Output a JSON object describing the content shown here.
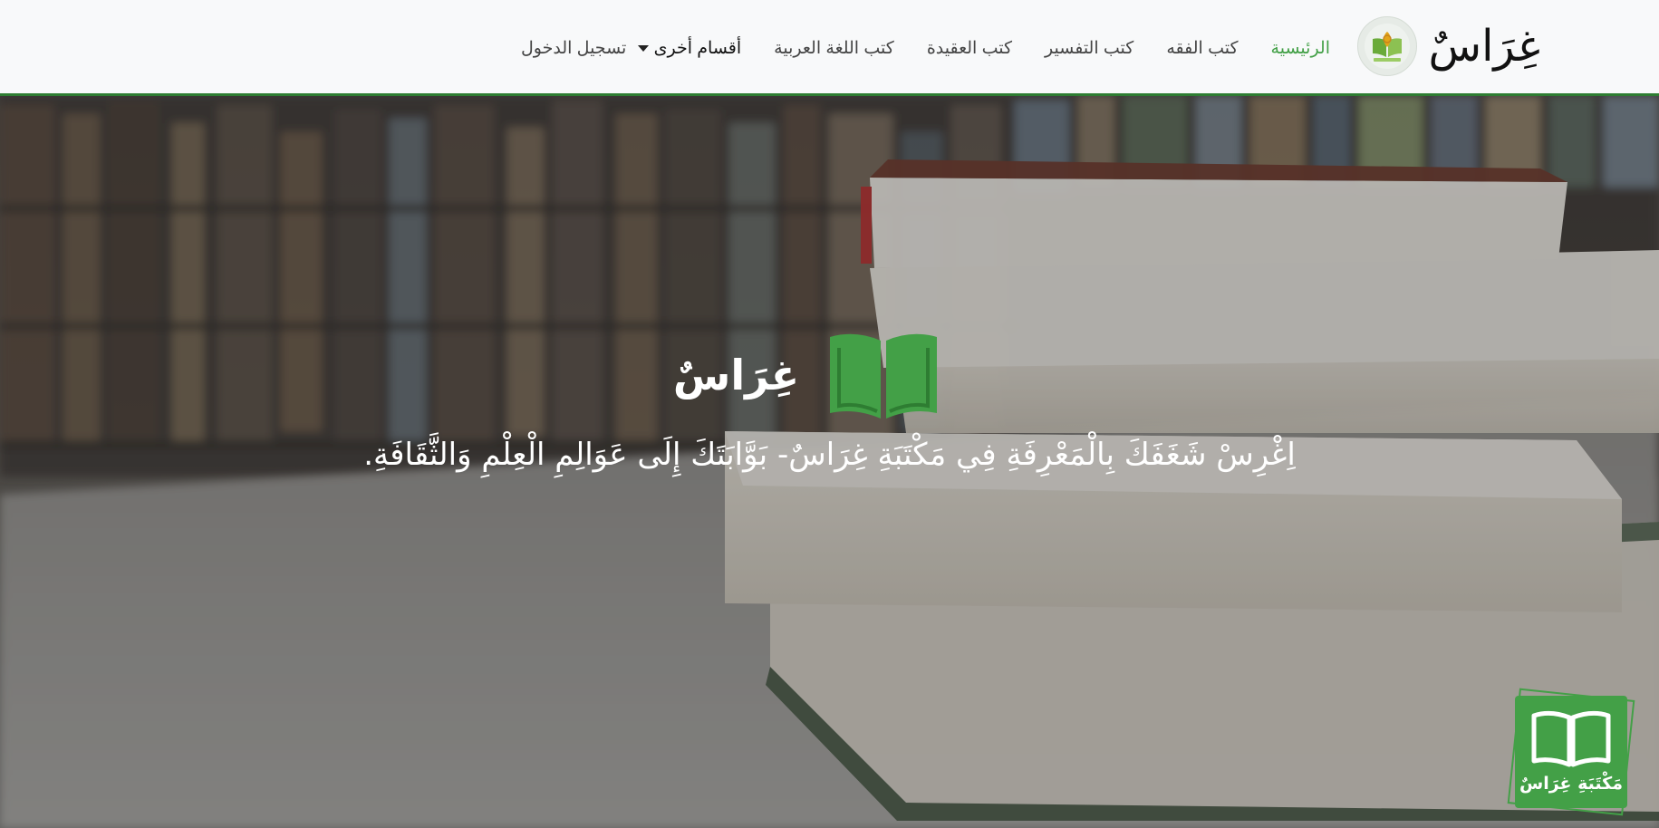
{
  "navbar": {
    "brand_name": "غِرَاسٌ",
    "logo": "garas-logo",
    "items": [
      {
        "label": "الرئيسية",
        "active": true
      },
      {
        "label": "كتب الفقه",
        "active": false
      },
      {
        "label": "كتب التفسير",
        "active": false
      },
      {
        "label": "كتب العقيدة",
        "active": false
      },
      {
        "label": "كتب اللغة العربية",
        "active": false
      }
    ],
    "dropdown_label": "أقسام أخرى",
    "login_label": "تسجيل الدخول"
  },
  "hero": {
    "title": "غِرَاسٌ",
    "icon": "open-book-icon",
    "tagline": "اِغْرِسْ شَغَفَكَ بِالْمَعْرِفَةِ فِي مَكْتَبَةِ غِرَاسٌ- بَوَّابَتَكَ إِلَى عَوَالِمِ الْعِلْمِ وَالثَّقَافَةِ."
  },
  "badge": {
    "label": "مَكْتَبَةِ غِرَاسٌ",
    "icon": "open-book-icon"
  },
  "colors": {
    "accent": "#43a047",
    "navbar_border": "#2e7d32",
    "navbar_bg": "#f8f9fa"
  }
}
